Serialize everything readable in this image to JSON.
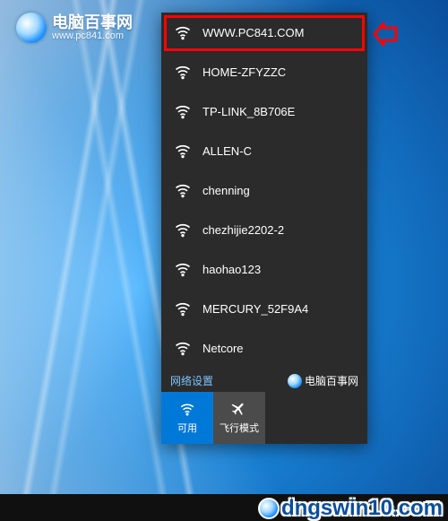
{
  "site_logo": {
    "cn": "电脑百事网",
    "url": "www.pc841.com"
  },
  "wifi": {
    "networks": [
      {
        "ssid": "WWW.PC841.COM"
      },
      {
        "ssid": "HOME-ZFYZZC"
      },
      {
        "ssid": "TP-LINK_8B706E"
      },
      {
        "ssid": "ALLEN-C"
      },
      {
        "ssid": "chenning"
      },
      {
        "ssid": "chezhijie2202-2"
      },
      {
        "ssid": "haohao123"
      },
      {
        "ssid": "MERCURY_52F9A4"
      },
      {
        "ssid": "Netcore"
      }
    ],
    "settings_label": "网络设置",
    "inline_logo_cn": "电脑百事网",
    "quick_actions": {
      "wifi": "可用",
      "airplane": "飞行模式"
    }
  },
  "watermark": "dngswin10.com"
}
